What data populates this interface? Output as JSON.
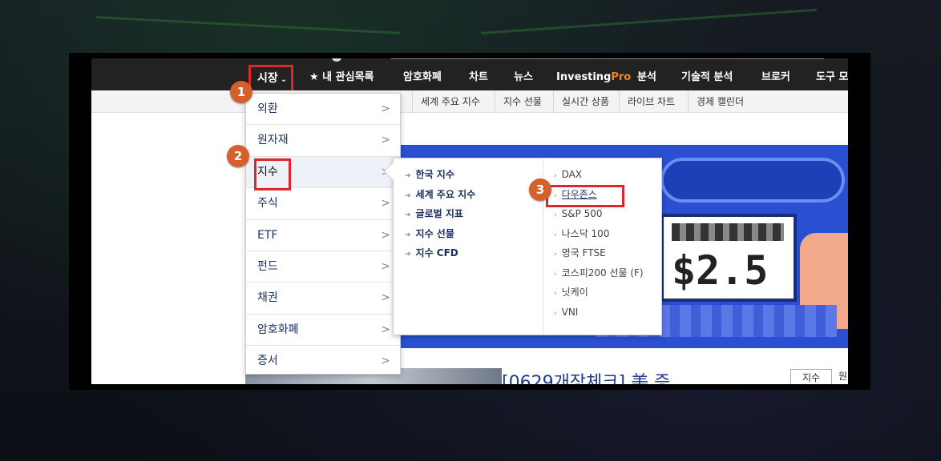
{
  "nav": {
    "market": "시장",
    "watchlist": "★ 내 관심목록",
    "crypto": "암호화폐",
    "charts": "차트",
    "news": "뉴스",
    "investing_pro_brand": "Investing",
    "investing_pro_suffix": "Pro",
    "analysis": "분석",
    "technical": "기술적 분석",
    "brokers": "브로커",
    "tools": "도구 모"
  },
  "subnav": [
    "세계 주요 지수",
    "지수 선물",
    "실시간 상품",
    "라이브 차트",
    "경제 캘린더"
  ],
  "menu1": [
    {
      "label": "외환",
      "arrow": ">"
    },
    {
      "label": "원자재",
      "arrow": ">"
    },
    {
      "label": "지수",
      "arrow": ">"
    },
    {
      "label": "주식",
      "arrow": ">"
    },
    {
      "label": "ETF",
      "arrow": ">"
    },
    {
      "label": "펀드",
      "arrow": ">"
    },
    {
      "label": "채권",
      "arrow": ">"
    },
    {
      "label": "암호화폐",
      "arrow": ">"
    },
    {
      "label": "증서",
      "arrow": ">"
    }
  ],
  "menu2_left": [
    "한국 지수",
    "세계 주요 지수",
    "글로벌 지표",
    "지수 선물",
    "지수 CFD"
  ],
  "menu2_right": [
    "DAX",
    "다우존스",
    "S&P 500",
    "나스닥 100",
    "영국 FTSE",
    "코스피200 선물 (F)",
    "닛케이",
    "VNI"
  ],
  "badges": [
    "1",
    "2",
    "3"
  ],
  "banner": {
    "price": "$2.5"
  },
  "headline": "[0629개장체크] 美 증",
  "tabs": {
    "index": "지수",
    "next": "원"
  },
  "colors": {
    "highlight": "#e0262d",
    "badge": "#d4602c",
    "pro": "#f5811f"
  }
}
